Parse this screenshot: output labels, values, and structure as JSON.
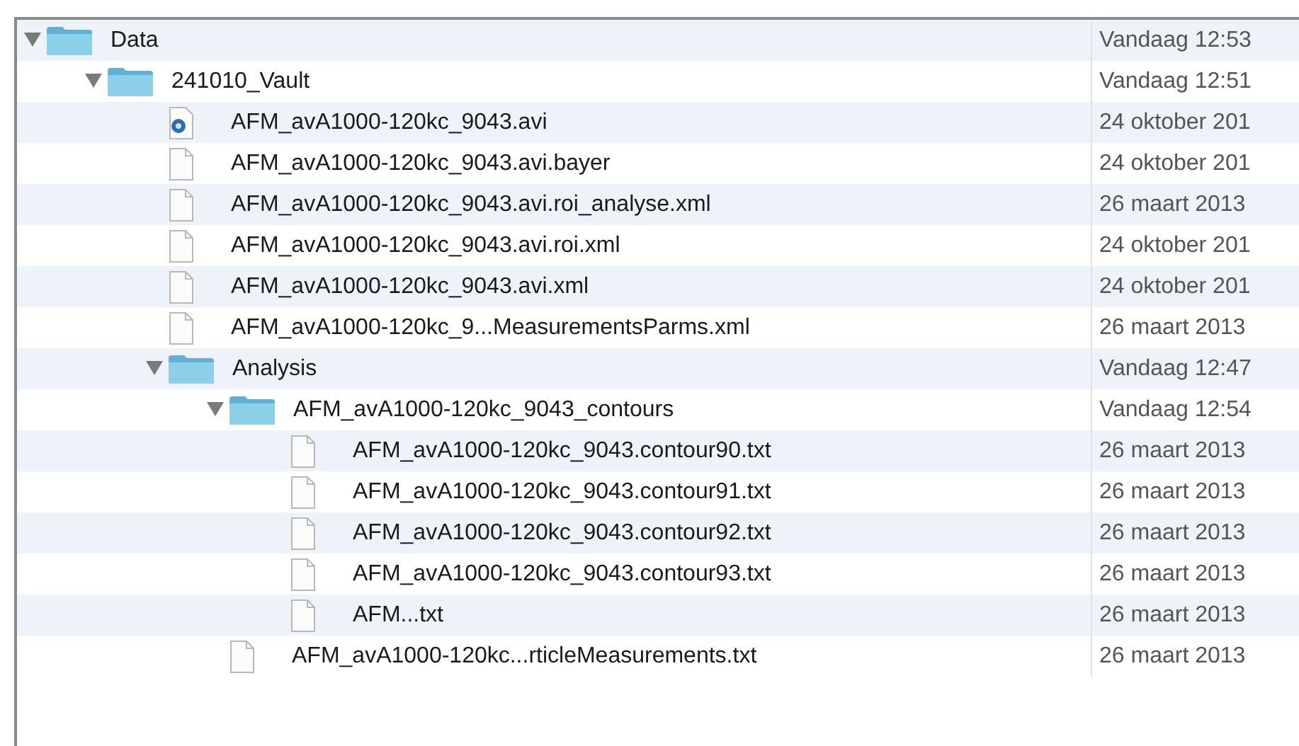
{
  "items": [
    {
      "kind": "folder",
      "name": "Data",
      "date": "Vandaag 12:53",
      "expanded": true,
      "children": [
        {
          "kind": "folder",
          "name": "241010_Vault",
          "date": "Vandaag 12:51",
          "expanded": true,
          "children": [
            {
              "kind": "video",
              "name": "AFM_avA1000-120kc_9043.avi",
              "date": "24 oktober 201"
            },
            {
              "kind": "file",
              "name": "AFM_avA1000-120kc_9043.avi.bayer",
              "date": "24 oktober 201"
            },
            {
              "kind": "file",
              "name": "AFM_avA1000-120kc_9043.avi.roi_analyse.xml",
              "date": "26 maart 2013"
            },
            {
              "kind": "file",
              "name": "AFM_avA1000-120kc_9043.avi.roi.xml",
              "date": "24 oktober 201"
            },
            {
              "kind": "file",
              "name": "AFM_avA1000-120kc_9043.avi.xml",
              "date": "24 oktober 201"
            },
            {
              "kind": "file",
              "name": "AFM_avA1000-120kc_9...MeasurementsParms.xml",
              "date": "26 maart 2013"
            },
            {
              "kind": "folder",
              "name": "Analysis",
              "date": "Vandaag 12:47",
              "expanded": true,
              "children": [
                {
                  "kind": "folder",
                  "name": "AFM_avA1000-120kc_9043_contours",
                  "date": "Vandaag 12:54",
                  "expanded": true,
                  "children": [
                    {
                      "kind": "file",
                      "name": "AFM_avA1000-120kc_9043.contour90.txt",
                      "date": "26 maart 2013"
                    },
                    {
                      "kind": "file",
                      "name": "AFM_avA1000-120kc_9043.contour91.txt",
                      "date": "26 maart 2013"
                    },
                    {
                      "kind": "file",
                      "name": "AFM_avA1000-120kc_9043.contour92.txt",
                      "date": "26 maart 2013"
                    },
                    {
                      "kind": "file",
                      "name": "AFM_avA1000-120kc_9043.contour93.txt",
                      "date": "26 maart 2013"
                    },
                    {
                      "kind": "file",
                      "name": "AFM...txt",
                      "date": "26 maart 2013"
                    }
                  ]
                },
                {
                  "kind": "file",
                  "name": "AFM_avA1000-120kc...rticleMeasurements.txt",
                  "date": "26 maart 2013"
                }
              ]
            }
          ]
        }
      ]
    }
  ]
}
